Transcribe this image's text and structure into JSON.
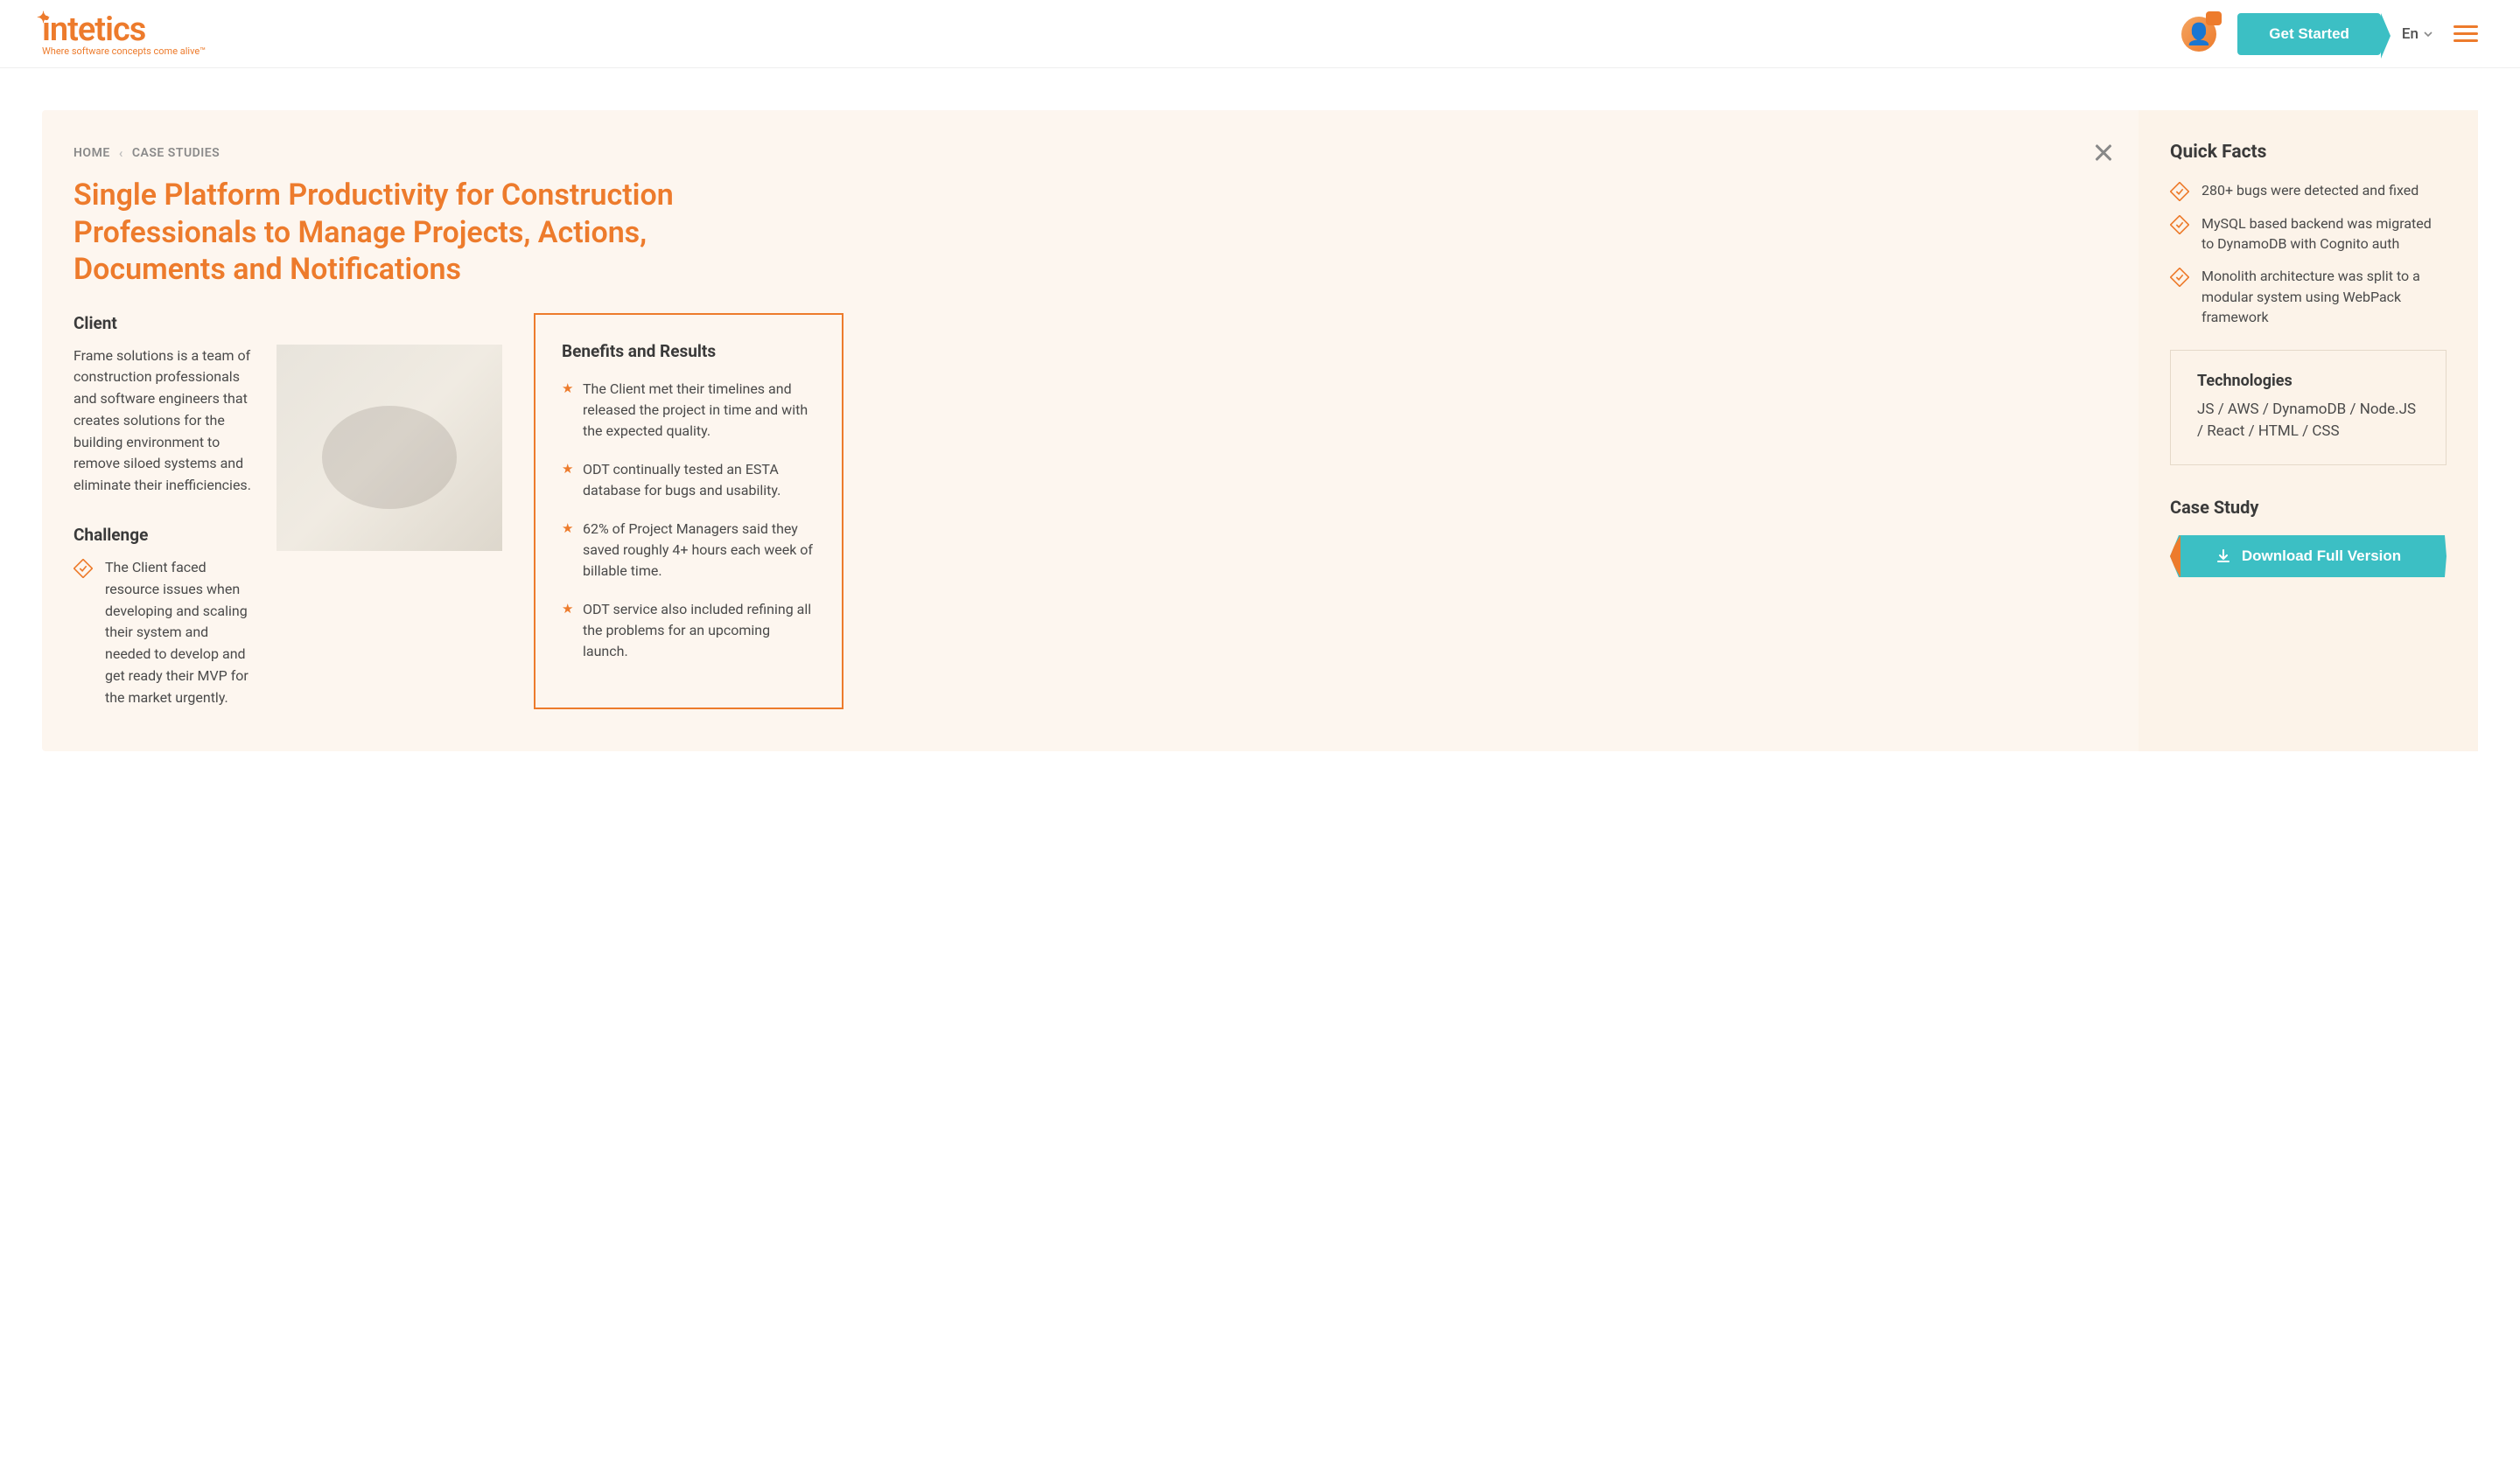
{
  "header": {
    "logo_text": "intetics",
    "logo_tagline": "Where software concepts come alive™",
    "get_started_label": "Get Started",
    "language": "En"
  },
  "breadcrumb": {
    "home": "HOME",
    "case_studies": "CASE STUDIES"
  },
  "page_title": "Single Platform Productivity for Construction Professionals to Manage Projects, Actions, Documents and Notifications",
  "client": {
    "heading": "Client",
    "body": "Frame solutions is a team of construction professionals and software engineers that creates solutions for the building environment to remove siloed systems and eliminate their inefficiencies."
  },
  "challenge": {
    "heading": "Challenge",
    "body": "The Client faced resource issues when developing and scaling their system and needed to develop and get ready their MVP for the market urgently."
  },
  "benefits": {
    "heading": "Benefits and Results",
    "items": [
      "The Client met their timelines and released the project in time and with the expected quality.",
      "ODT continually tested an ESTA database for bugs and usability.",
      "62% of Project Managers said they saved roughly 4+ hours each week of billable time.",
      "ODT service also included refining all the problems for an upcoming launch."
    ]
  },
  "quick_facts": {
    "heading": "Quick Facts",
    "items": [
      "280+ bugs were detected and fixed",
      "MySQL based backend was migrated to DynamoDB with Cognito auth",
      "Monolith architecture was split to a modular system using WebPack framework"
    ]
  },
  "technologies": {
    "heading": "Technologies",
    "list": "JS / AWS / DynamoDB / Node.JS / React / HTML / CSS"
  },
  "case_study": {
    "heading": "Case Study",
    "download_label": "Download Full Version"
  }
}
